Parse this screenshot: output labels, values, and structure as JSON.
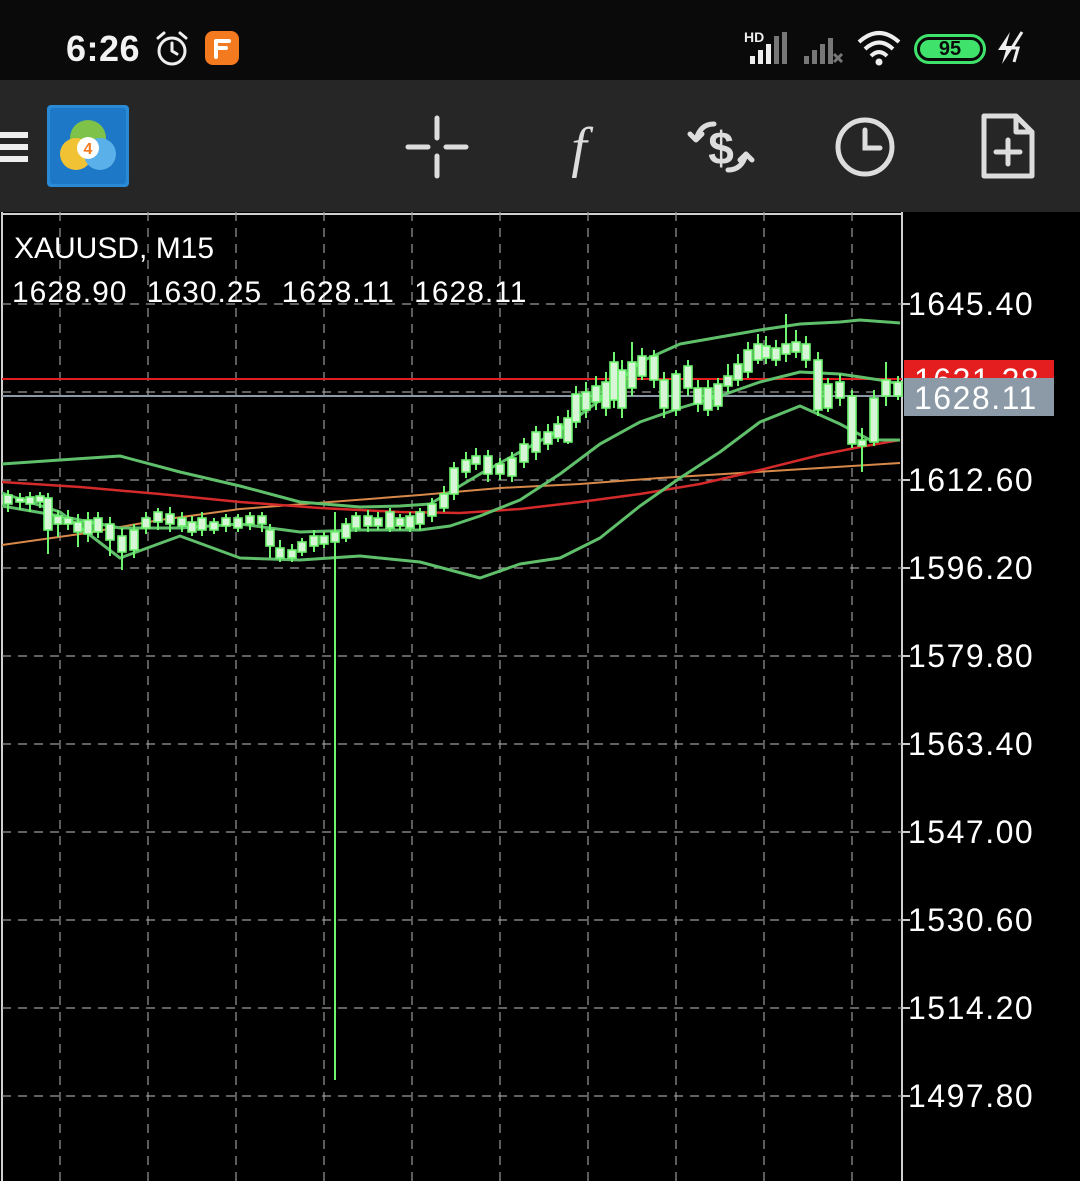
{
  "status_bar": {
    "time": "6:26",
    "battery_level": "95",
    "icons": [
      "alarm-icon",
      "app-notification-icon",
      "hd-signal-icon",
      "signal-icon",
      "wifi-icon",
      "battery-icon",
      "charging-icon"
    ],
    "accent_battery": "#3fe36b"
  },
  "toolbar": {
    "icons": [
      "menu-icon",
      "metatrader-logo-icon",
      "crosshair-icon",
      "indicators-icon",
      "trade-icon",
      "timeframe-icon",
      "new-order-icon"
    ],
    "background": "#262626"
  },
  "chart": {
    "symbol_label": "XAUUSD, M15",
    "ohlc": {
      "open": "1628.90",
      "high": "1630.25",
      "low": "1628.11",
      "close": "1628.11"
    },
    "price_axis": [
      "1645.40",
      "1612.60",
      "1596.20",
      "1579.80",
      "1563.40",
      "1547.00",
      "1530.60",
      "1514.20",
      "1497.80"
    ],
    "ask_tag": "1631.28",
    "bid_tag": "1628.11",
    "colors": {
      "candle": "#6ff46f",
      "bollinger": "#5fbf6a",
      "ma_red": "#d42a2a",
      "ma_orange": "#d8894a",
      "grid": "#9a9a9a",
      "ask_line": "#e41e1e",
      "bid_line": "#8b9aa6"
    }
  }
}
